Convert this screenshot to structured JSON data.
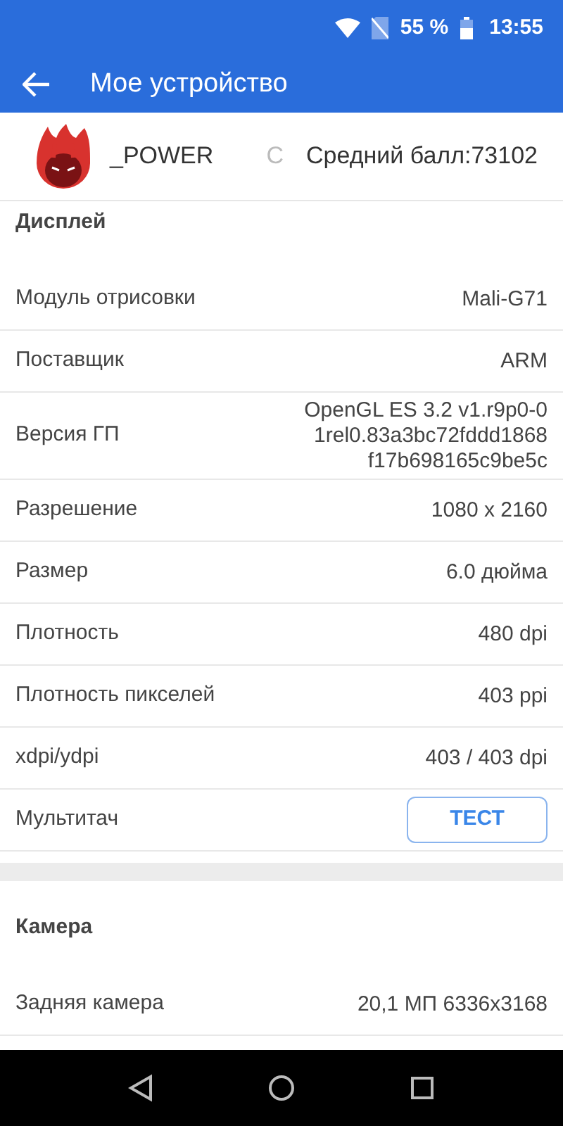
{
  "status_bar": {
    "battery": "55 %",
    "time": "13:55"
  },
  "app_bar": {
    "title": "Мое устройство"
  },
  "header": {
    "tabs": [
      {
        "label": "_POWER",
        "faded": false
      },
      {
        "label": "С",
        "faded": true
      },
      {
        "label": "Средний балл:73102",
        "faded": false
      }
    ]
  },
  "sections": [
    {
      "title": "Дисплей",
      "rows": [
        {
          "kind": "text",
          "label": "Модуль отрисовки",
          "value": "Mali-G71"
        },
        {
          "kind": "text",
          "label": "Поставщик",
          "value": "ARM"
        },
        {
          "kind": "text",
          "label": "Версия ГП",
          "value_lines": [
            "OpenGL ES 3.2 v1.r9p0-0",
            "1rel0.83a3bc72fddd1868",
            "f17b698165c9be5c"
          ]
        },
        {
          "kind": "text",
          "label": "Разрешение",
          "value": "1080 x 2160"
        },
        {
          "kind": "text",
          "label": "Размер",
          "value": "6.0 дюйма"
        },
        {
          "kind": "text",
          "label": "Плотность",
          "value": "480 dpi"
        },
        {
          "kind": "text",
          "label": "Плотность пикселей",
          "value": "403 ppi"
        },
        {
          "kind": "text",
          "label": "xdpi/ydpi",
          "value": "403 / 403 dpi"
        },
        {
          "kind": "button",
          "label": "Мультитач",
          "button": "ТЕСТ"
        }
      ]
    },
    {
      "title": "Камера",
      "rows": [
        {
          "kind": "text",
          "label": "Задняя камера",
          "value": "20,1 МП 6336x3168"
        }
      ]
    }
  ]
}
